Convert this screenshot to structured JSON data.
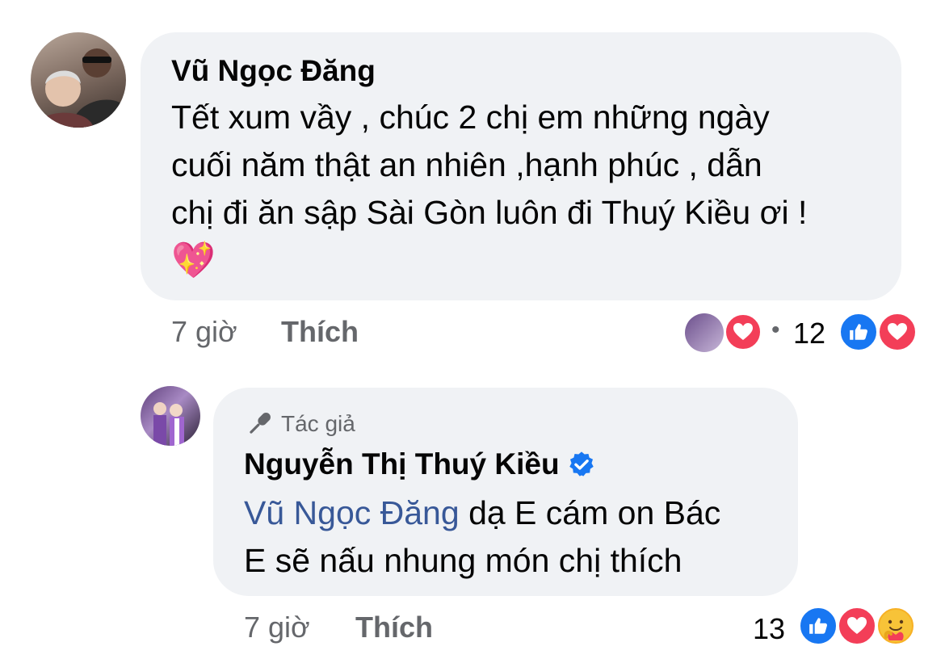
{
  "comment1": {
    "author": "Vũ Ngọc Đăng",
    "lines": [
      "Tết xum vầy , chúc 2 chị em những ngày",
      "cuối năm thật an nhiên ,hạnh phúc , dẫn",
      "chị đi ăn sập Sài Gòn luôn đi Thuý Kiều ơi !"
    ],
    "emoji": "💖",
    "time": "7 giờ",
    "like_label": "Thích",
    "reply_count_separator": "•",
    "reaction_count": "12"
  },
  "reply1": {
    "badge_label": "Tác giả",
    "author": "Nguyễn Thị Thuý Kiều",
    "mention": "Vũ Ngọc Đăng",
    "line1_rest": " dạ E cám on Bác",
    "line2": "E sẽ nấu nhung món chị thích",
    "time": "7 giờ",
    "like_label": "Thích",
    "reaction_count": "13"
  },
  "colors": {
    "like_blue": "#1877f2",
    "love_red": "#f33e58",
    "care_yellow": "#f7b125",
    "verified_blue": "#1877f2",
    "mention_blue": "#385898",
    "bubble_bg": "#f0f2f5"
  }
}
